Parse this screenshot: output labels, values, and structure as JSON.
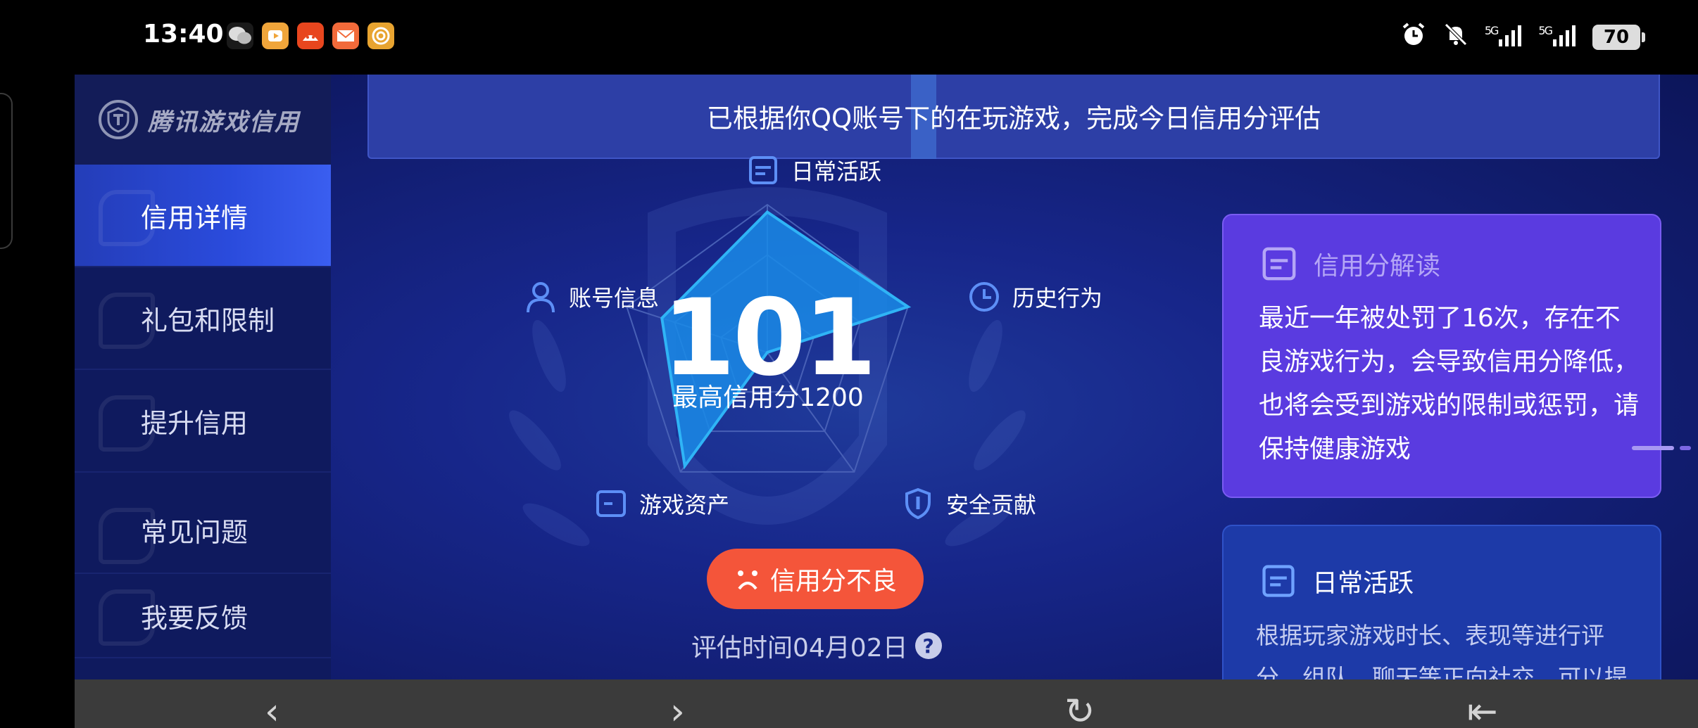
{
  "status_bar": {
    "time": "13:40",
    "battery": "70",
    "signal_1": "5G",
    "signal_2": "5G",
    "app_icons": [
      "wechat-icon",
      "video-app-icon",
      "taobao-icon",
      "mail-app-icon",
      "target-app-icon"
    ],
    "status_icons": [
      "alarm-icon",
      "mute-icon"
    ]
  },
  "sidebar": {
    "logo_text": "腾讯游戏信用",
    "items": [
      {
        "label": "信用详情",
        "active": true
      },
      {
        "label": "礼包和限制",
        "active": false
      },
      {
        "label": "提升信用",
        "active": false
      },
      {
        "label": "常见问题",
        "active": false
      },
      {
        "label": "我要反馈",
        "active": false
      }
    ]
  },
  "banner": {
    "text": "已根据你QQ账号下的在玩游戏，完成今日信用分评估"
  },
  "radar": {
    "dimensions": [
      {
        "label": "日常活跃",
        "icon": "document-icon"
      },
      {
        "label": "历史行为",
        "icon": "clock-icon"
      },
      {
        "label": "安全贡献",
        "icon": "shield-icon"
      },
      {
        "label": "游戏资产",
        "icon": "wallet-icon"
      },
      {
        "label": "账号信息",
        "icon": "user-icon"
      }
    ],
    "values": [
      0.95,
      1.0,
      0.0,
      0.95,
      0.75
    ],
    "colors": {
      "fill": "#1a8be8",
      "stroke": "#2fb4f6",
      "grid": "#4860b6"
    }
  },
  "score": {
    "value": "101",
    "max_label": "最高信用分1200"
  },
  "status_button": {
    "label": "信用分不良",
    "icon": "sad-face-icon",
    "color": "#f4553a"
  },
  "evaluation": {
    "time_label": "评估时间04月02日",
    "help_icon": "?"
  },
  "interpretation_card": {
    "title": "信用分解读",
    "body": "最近一年被处罚了16次，存在不良游戏行为，会导致信用分降低，也将会受到游戏的限制或惩罚，请保持健康游戏"
  },
  "activity_card": {
    "title": "日常活跃",
    "body": "根据玩家游戏时长、表现等进行评分。组队、聊天等正向社交，可以提升信用分。严"
  },
  "bottom_nav": {
    "icons": [
      "back-icon",
      "forward-icon",
      "refresh-icon",
      "exit-icon"
    ],
    "glyphs": [
      "‹",
      "›",
      "↻",
      "⇤"
    ]
  }
}
